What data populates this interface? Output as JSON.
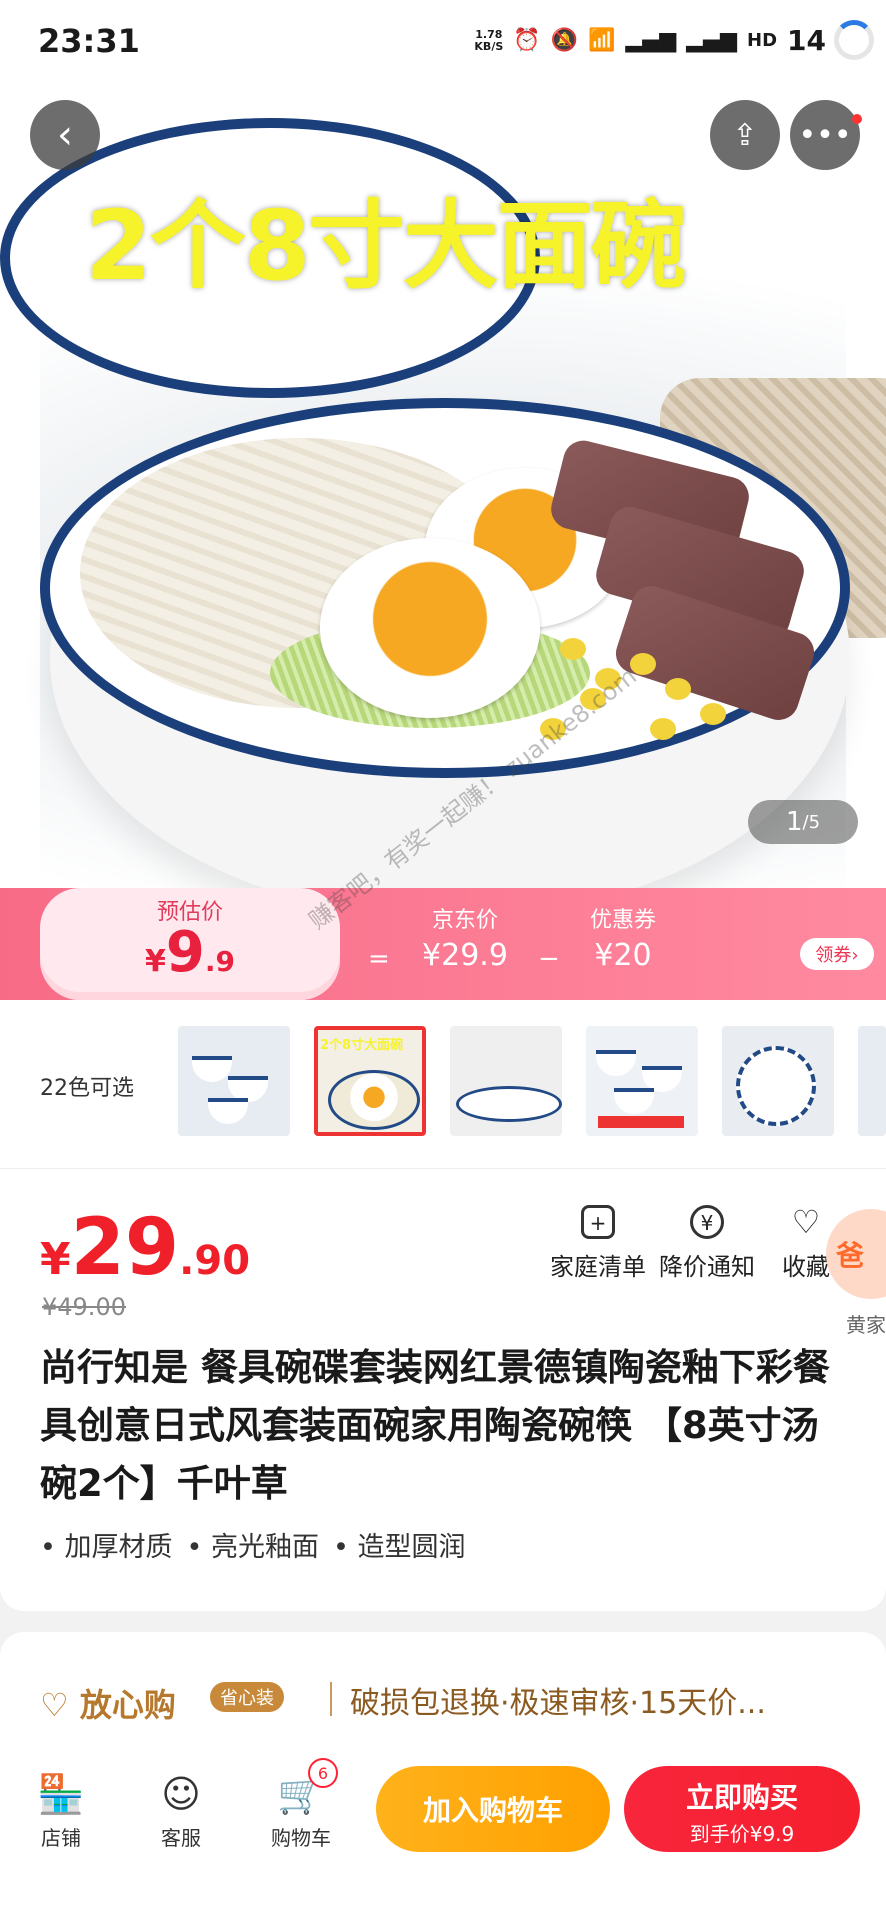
{
  "status_bar": {
    "time": "23:31",
    "net_speed": "1.78\nKB/S",
    "battery": "14"
  },
  "hero": {
    "headline": "2个8寸大面碗",
    "counter_current": "1",
    "counter_total": "/5"
  },
  "price_banner": {
    "estimated_label": "预估价",
    "estimated_symbol": "¥",
    "estimated_int": "9",
    "estimated_dec": ".9",
    "equals": "=",
    "jd_label": "京东价",
    "jd_value": "¥29.9",
    "minus": "−",
    "coupon_label": "优惠券",
    "coupon_value": "¥20",
    "coupon_button": "领券›",
    "watermark": "赚客吧，有奖一起赚！ zuanke8.com"
  },
  "colors": {
    "label": "22色可选",
    "selected_index": 1,
    "selected_overlay": "2个8寸大面碗"
  },
  "product": {
    "price_symbol": "¥",
    "price_int": "29",
    "price_dec": ".90",
    "original_price": "¥49.00",
    "actions": [
      {
        "label": "家庭清单",
        "icon": "list-add-icon"
      },
      {
        "label": "降价通知",
        "icon": "price-drop-icon"
      },
      {
        "label": "收藏",
        "icon": "heart-icon"
      }
    ],
    "float_badge": "爸",
    "float_text": "黄家",
    "title": "尚行知是 餐具碗碟套装网红景德镇陶瓷釉下彩餐具创意日式风套装面碗家用陶瓷碗筷 【8英寸汤碗2个】千叶草",
    "features": [
      "• 加厚材质",
      "• 亮光釉面",
      "• 造型圆润"
    ]
  },
  "assurance": {
    "brand": "放心购",
    "tag": "省心装",
    "text": "破损包退换·极速审核·15天价..."
  },
  "bottom_bar": {
    "nav": [
      {
        "label": "店铺",
        "icon": "store-icon"
      },
      {
        "label": "客服",
        "icon": "customer-service-icon"
      },
      {
        "label": "购物车",
        "icon": "cart-icon"
      }
    ],
    "cart_count": "6",
    "add_to_cart": "加入购物车",
    "buy_now": "立即购买",
    "buy_now_sub": "到手价¥9.9"
  },
  "colors_palette": {
    "accent_red": "#f0202a",
    "banner_pink": "#f86b87",
    "cart_orange": "#ffa000",
    "assure_gold": "#b6782c"
  }
}
